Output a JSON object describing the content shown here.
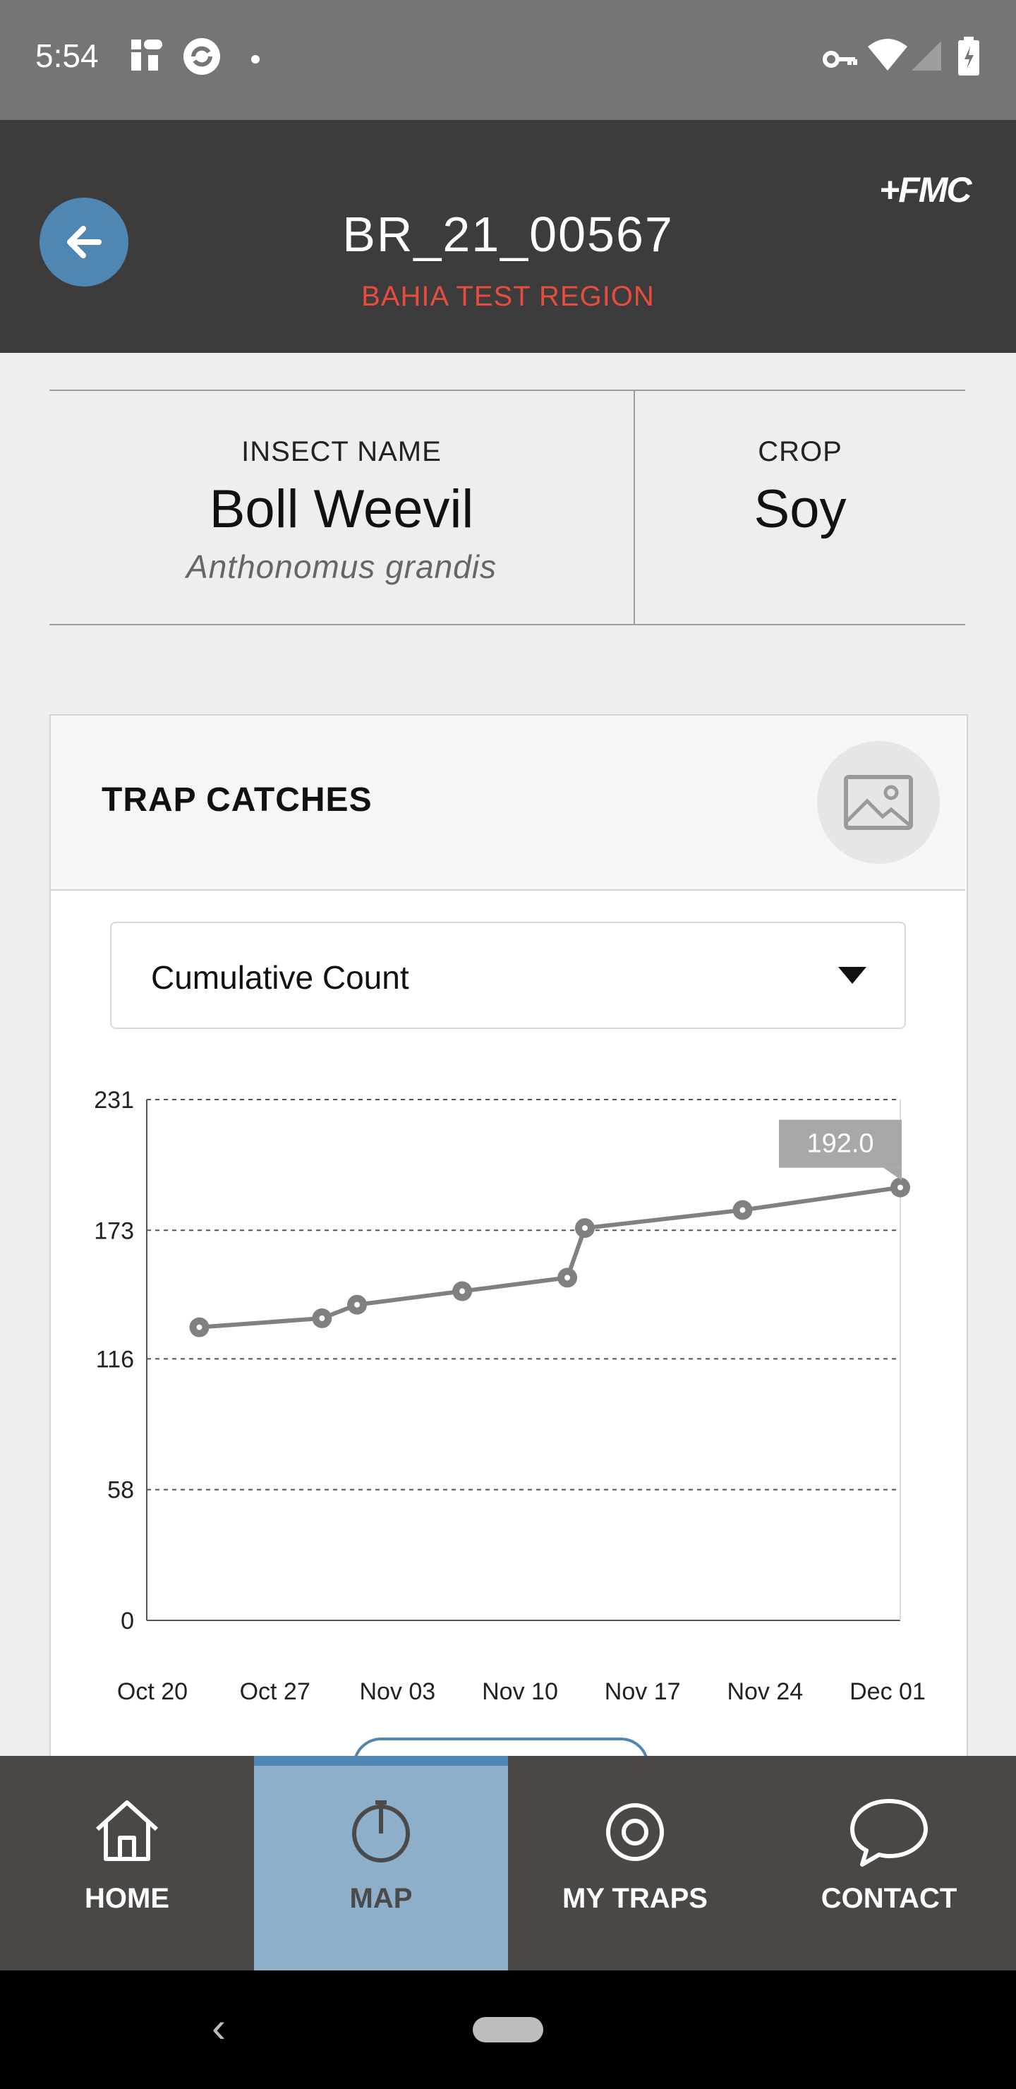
{
  "status_bar": {
    "time": "5:54"
  },
  "header": {
    "trap_id": "BR_21_00567",
    "region": "BAHIA TEST REGION",
    "logo_text": "FMC",
    "back_icon": "arrow-left-icon"
  },
  "info": {
    "insect_label": "INSECT NAME",
    "insect_name": "Boll Weevil",
    "insect_scientific": "Anthonomus grandis",
    "crop_label": "CROP",
    "crop_value": "Soy"
  },
  "trap_catches": {
    "title": "TRAP CATCHES",
    "image_icon": "image-icon",
    "dropdown_value": "Cumulative Count"
  },
  "chart_data": {
    "type": "line",
    "title": "",
    "xlabel": "",
    "ylabel": "",
    "y_ticks": [
      "231",
      "173",
      "116",
      "58",
      "0"
    ],
    "x_ticks": [
      "Oct 20",
      "Oct 27",
      "Nov 03",
      "Nov 10",
      "Nov 17",
      "Nov 24",
      "Dec 01"
    ],
    "ylim": [
      0,
      231
    ],
    "x_range": [
      "2021-10-20",
      "2021-12-02"
    ],
    "points": [
      {
        "x": "2021-10-23",
        "y": 130
      },
      {
        "x": "2021-10-30",
        "y": 134
      },
      {
        "x": "2021-11-01",
        "y": 140
      },
      {
        "x": "2021-11-07",
        "y": 146
      },
      {
        "x": "2021-11-13",
        "y": 152
      },
      {
        "x": "2021-11-14",
        "y": 174
      },
      {
        "x": "2021-11-23",
        "y": 182
      },
      {
        "x": "2021-12-02",
        "y": 192
      }
    ],
    "tooltip": "192.0",
    "grid": true,
    "line_color": "#808080"
  },
  "bottom_nav": {
    "items": [
      {
        "label": "HOME",
        "icon": "home-icon"
      },
      {
        "label": "MAP",
        "icon": "map-icon"
      },
      {
        "label": "MY TRAPS",
        "icon": "target-icon"
      },
      {
        "label": "CONTACT",
        "icon": "chat-bubble-icon"
      }
    ],
    "active": "MAP"
  },
  "colors": {
    "accent_blue": "#4f86b2",
    "region_red": "#e74c3c",
    "header_bg": "#3c3c3c",
    "nav_bg": "#4b4745",
    "nav_active_bg": "#8eafc9"
  }
}
